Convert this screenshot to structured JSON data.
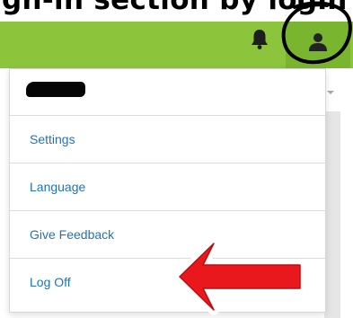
{
  "annotation_caption": "gn-in section by login",
  "topbar": {
    "bell_icon": "bell-icon",
    "user_icon": "user-icon",
    "colors": {
      "bar": "#8cc43c",
      "user_button": "#7ab52f"
    }
  },
  "menu": {
    "header_redacted": true,
    "items": [
      {
        "label": "Settings"
      },
      {
        "label": "Language"
      },
      {
        "label": "Give Feedback"
      },
      {
        "label": "Log Off"
      }
    ],
    "colors": {
      "link": "#1f74b6",
      "divider": "#dcdcdc"
    }
  },
  "annotations": {
    "circle_color": "#000000",
    "arrow_color": "#e8181c"
  }
}
